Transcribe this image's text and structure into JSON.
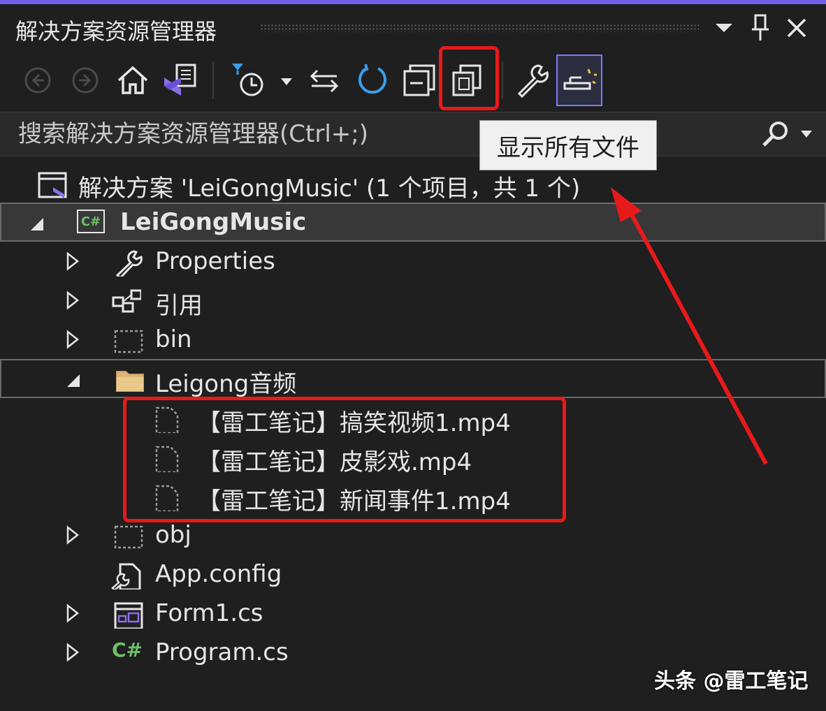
{
  "window": {
    "title": "解决方案资源管理器"
  },
  "titlebar_icons": [
    "dropdown-arrow-icon",
    "pin-icon",
    "close-icon"
  ],
  "toolbar": {
    "buttons": [
      "back-icon",
      "forward-icon",
      "home-icon",
      "switch-view-icon",
      "pending-changes-filter-icon",
      "sync-icon",
      "refresh-icon",
      "collapse-all-icon",
      "show-all-files-icon",
      "properties-icon",
      "preview-selected-icon"
    ]
  },
  "search": {
    "placeholder": "搜索解决方案资源管理器(Ctrl+;)"
  },
  "tooltip": {
    "text": "显示所有文件"
  },
  "tree": {
    "solution": "解决方案 'LeiGongMusic' (1 个项目，共 1 个)",
    "project": "LeiGongMusic",
    "project_badge": "C#",
    "items": [
      {
        "label": "Properties"
      },
      {
        "label": "引用"
      },
      {
        "label": "bin"
      },
      {
        "label": "Leigong音频"
      },
      {
        "label": "【雷工笔记】搞笑视频1.mp4"
      },
      {
        "label": "【雷工笔记】皮影戏.mp4"
      },
      {
        "label": "【雷工笔记】新闻事件1.mp4"
      },
      {
        "label": "obj"
      },
      {
        "label": "App.config"
      },
      {
        "label": "Form1.cs"
      },
      {
        "label": "Program.cs"
      }
    ]
  },
  "colors": {
    "accent": "#7160e8",
    "highlight_red": "#e8191b",
    "background": "#1f1f1f",
    "csharp_green": "#6dbf67"
  },
  "watermark": "头条 @雷工笔记"
}
